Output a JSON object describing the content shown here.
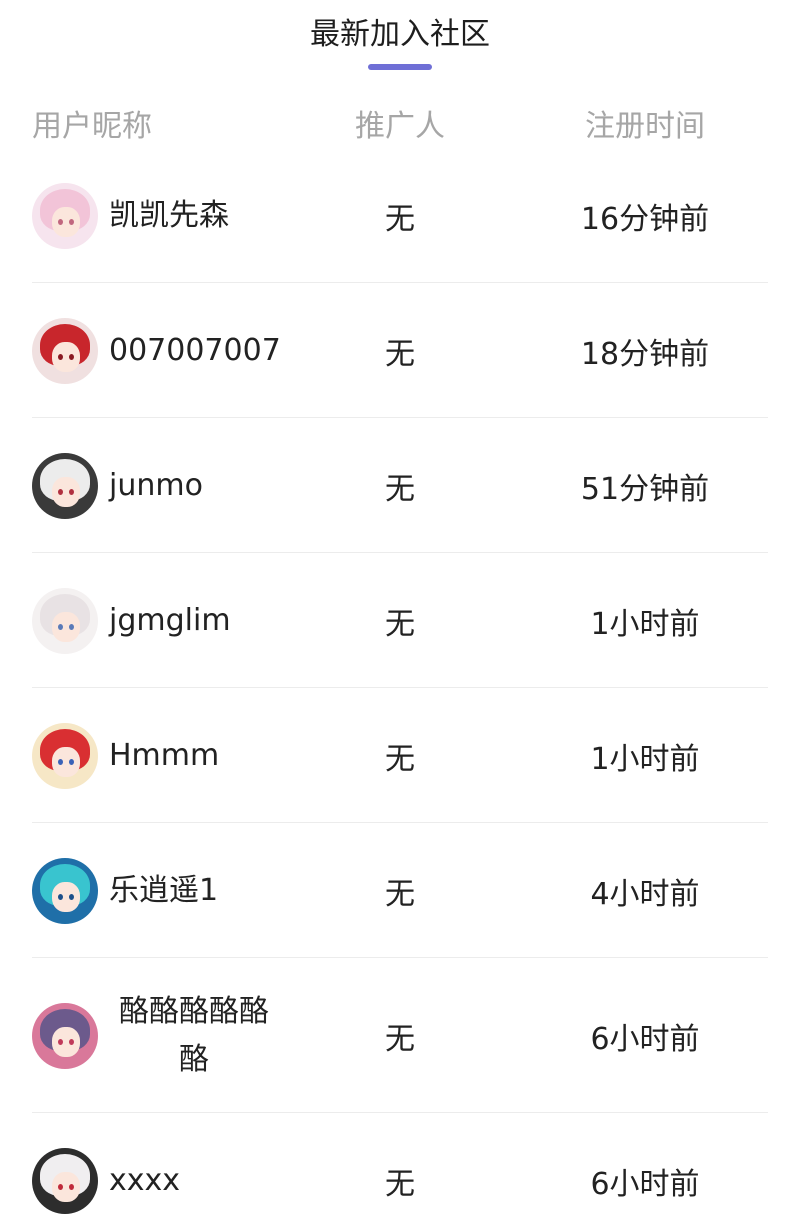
{
  "tab": {
    "title": "最新加入社区",
    "indicator_color": "#6f6fd6"
  },
  "columns": {
    "user": "用户昵称",
    "referrer": "推广人",
    "time": "注册时间"
  },
  "rows": [
    {
      "nickname": "凯凯先森",
      "referrer": "无",
      "time": "16分钟前",
      "avatar": {
        "bg": "#f6e4ee",
        "hair": "#f2c4d8",
        "eye": "#c0667e"
      }
    },
    {
      "nickname": "007007007",
      "referrer": "无",
      "time": "18分钟前",
      "avatar": {
        "bg": "#f0e0e0",
        "hair": "#c8262c",
        "eye": "#8a1a22"
      }
    },
    {
      "nickname": "junmo",
      "referrer": "无",
      "time": "51分钟前",
      "avatar": {
        "bg": "#3a3a3a",
        "hair": "#ececec",
        "eye": "#b03040"
      }
    },
    {
      "nickname": "jgmglim",
      "referrer": "无",
      "time": "1小时前",
      "avatar": {
        "bg": "#f4f1f1",
        "hair": "#e8e2e4",
        "eye": "#5a7ab8"
      }
    },
    {
      "nickname": "Hmmm",
      "referrer": "无",
      "time": "1小时前",
      "avatar": {
        "bg": "#f6e7c6",
        "hair": "#d92f32",
        "eye": "#3a62b8"
      }
    },
    {
      "nickname": "乐逍遥1",
      "referrer": "无",
      "time": "4小时前",
      "avatar": {
        "bg": "#1f6fa8",
        "hair": "#39c4cf",
        "eye": "#1c4f8a"
      }
    },
    {
      "nickname": "酪酪酪酪酪酪",
      "referrer": "无",
      "time": "6小时前",
      "avatar": {
        "bg": "#d9789a",
        "hair": "#6c5a8c",
        "eye": "#c03a5a"
      }
    },
    {
      "nickname": "xxxx",
      "referrer": "无",
      "time": "6小时前",
      "avatar": {
        "bg": "#2d2d2d",
        "hair": "#f0eef0",
        "eye": "#c02a3a"
      }
    }
  ]
}
